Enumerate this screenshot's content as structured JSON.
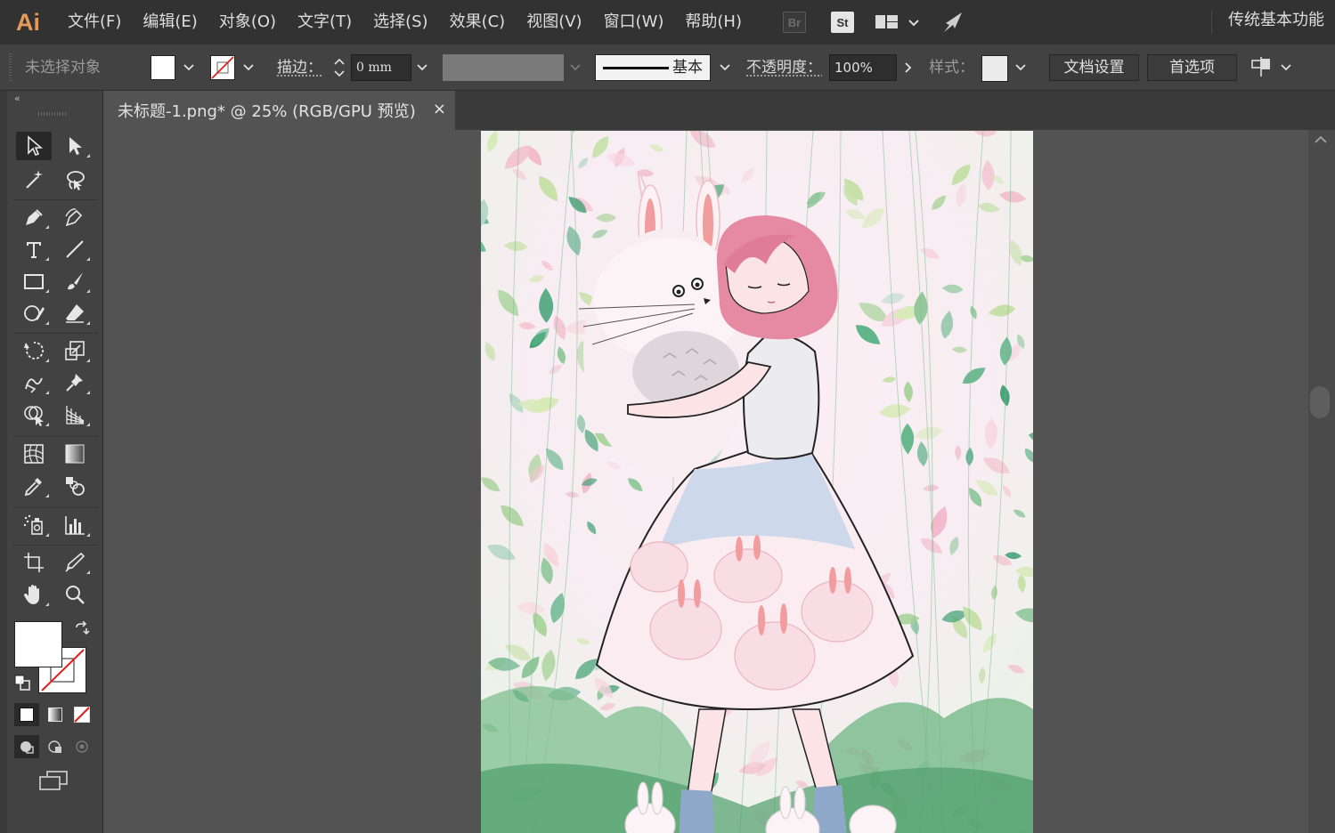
{
  "app": {
    "logo": "Ai",
    "workspace": "传统基本功能"
  },
  "menu": {
    "items": [
      "文件(F)",
      "编辑(E)",
      "对象(O)",
      "文字(T)",
      "选择(S)",
      "效果(C)",
      "视图(V)",
      "窗口(W)",
      "帮助(H)"
    ],
    "bridge": "Br",
    "stock": "St"
  },
  "control": {
    "selection_status": "未选择对象",
    "stroke_label": "描边：",
    "stroke_value": "0 mm",
    "stroke_profile": "基本",
    "opacity_label": "不透明度：",
    "opacity_value": "100%",
    "style_label": "样式：",
    "doc_setup_button": "文档设置",
    "preferences_button": "首选项"
  },
  "document": {
    "tab_title": "未标题-1.png* @ 25% (RGB/GPU 预览)",
    "close_glyph": "×"
  },
  "toolbox": {
    "collapse_glyph": "«"
  },
  "colors": {
    "accent_logo": "#e39a58",
    "menubar": "#323232",
    "panel": "#424242",
    "canvas": "#535353"
  }
}
